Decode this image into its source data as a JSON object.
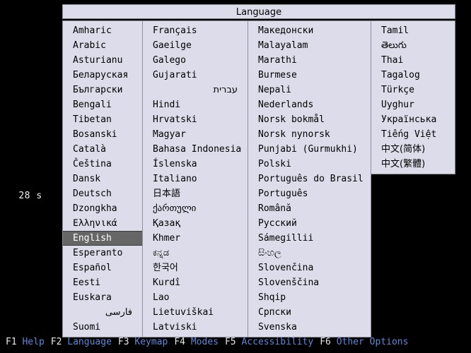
{
  "screen": {
    "background": "#000000",
    "timer": "28 s"
  },
  "dialog": {
    "title": "Language",
    "panel_bg": "#dcdcea",
    "selected_bg": "#666666",
    "selected_fg": "#ffffff",
    "columns": [
      {
        "name": "language-column-1",
        "items": [
          {
            "label": "Amharic",
            "selected": false,
            "script": "latin"
          },
          {
            "label": "Arabic",
            "selected": false,
            "script": "latin"
          },
          {
            "label": "Asturianu",
            "selected": false,
            "script": "latin"
          },
          {
            "label": "Беларуская",
            "selected": false,
            "script": "cyrillic"
          },
          {
            "label": "Български",
            "selected": false,
            "script": "cyrillic"
          },
          {
            "label": "Bengali",
            "selected": false,
            "script": "latin"
          },
          {
            "label": "Tibetan",
            "selected": false,
            "script": "latin"
          },
          {
            "label": "Bosanski",
            "selected": false,
            "script": "latin"
          },
          {
            "label": "Català",
            "selected": false,
            "script": "latin"
          },
          {
            "label": "Čeština",
            "selected": false,
            "script": "latin"
          },
          {
            "label": "Dansk",
            "selected": false,
            "script": "latin"
          },
          {
            "label": "Deutsch",
            "selected": false,
            "script": "latin"
          },
          {
            "label": "Dzongkha",
            "selected": false,
            "script": "latin"
          },
          {
            "label": "Ελληνικά",
            "selected": false,
            "script": "greek"
          },
          {
            "label": "English",
            "selected": true,
            "script": "latin"
          },
          {
            "label": "Esperanto",
            "selected": false,
            "script": "latin"
          },
          {
            "label": "Español",
            "selected": false,
            "script": "latin"
          },
          {
            "label": "Eesti",
            "selected": false,
            "script": "latin"
          },
          {
            "label": "Euskara",
            "selected": false,
            "script": "latin"
          },
          {
            "label": "فارسی",
            "selected": false,
            "script": "rtl"
          },
          {
            "label": "Suomi",
            "selected": false,
            "script": "latin"
          }
        ]
      },
      {
        "name": "language-column-2",
        "items": [
          {
            "label": "Français",
            "selected": false,
            "script": "latin"
          },
          {
            "label": "Gaeilge",
            "selected": false,
            "script": "latin"
          },
          {
            "label": "Galego",
            "selected": false,
            "script": "latin"
          },
          {
            "label": "Gujarati",
            "selected": false,
            "script": "latin"
          },
          {
            "label": "עברית",
            "selected": false,
            "script": "rtl"
          },
          {
            "label": "Hindi",
            "selected": false,
            "script": "latin"
          },
          {
            "label": "Hrvatski",
            "selected": false,
            "script": "latin"
          },
          {
            "label": "Magyar",
            "selected": false,
            "script": "latin"
          },
          {
            "label": "Bahasa Indonesia",
            "selected": false,
            "script": "latin"
          },
          {
            "label": "Íslenska",
            "selected": false,
            "script": "latin"
          },
          {
            "label": "Italiano",
            "selected": false,
            "script": "latin"
          },
          {
            "label": "日本語",
            "selected": false,
            "script": "cjk"
          },
          {
            "label": "ქართული",
            "selected": false,
            "script": "cjk"
          },
          {
            "label": "Қазақ",
            "selected": false,
            "script": "cyrillic"
          },
          {
            "label": "Khmer",
            "selected": false,
            "script": "latin"
          },
          {
            "label": "ಕನ್ನಡ",
            "selected": false,
            "script": "cjk"
          },
          {
            "label": "한국어",
            "selected": false,
            "script": "cjk"
          },
          {
            "label": "Kurdî",
            "selected": false,
            "script": "latin"
          },
          {
            "label": "Lao",
            "selected": false,
            "script": "latin"
          },
          {
            "label": "Lietuviškai",
            "selected": false,
            "script": "latin"
          },
          {
            "label": "Latviski",
            "selected": false,
            "script": "latin"
          }
        ]
      },
      {
        "name": "language-column-3",
        "items": [
          {
            "label": "Македонски",
            "selected": false,
            "script": "cyrillic"
          },
          {
            "label": "Malayalam",
            "selected": false,
            "script": "latin"
          },
          {
            "label": "Marathi",
            "selected": false,
            "script": "latin"
          },
          {
            "label": "Burmese",
            "selected": false,
            "script": "latin"
          },
          {
            "label": "Nepali",
            "selected": false,
            "script": "latin"
          },
          {
            "label": "Nederlands",
            "selected": false,
            "script": "latin"
          },
          {
            "label": "Norsk bokmål",
            "selected": false,
            "script": "latin"
          },
          {
            "label": "Norsk nynorsk",
            "selected": false,
            "script": "latin"
          },
          {
            "label": "Punjabi (Gurmukhi)",
            "selected": false,
            "script": "latin"
          },
          {
            "label": "Polski",
            "selected": false,
            "script": "latin"
          },
          {
            "label": "Português do Brasil",
            "selected": false,
            "script": "latin"
          },
          {
            "label": "Português",
            "selected": false,
            "script": "latin"
          },
          {
            "label": "Română",
            "selected": false,
            "script": "latin"
          },
          {
            "label": "Русский",
            "selected": false,
            "script": "cyrillic"
          },
          {
            "label": "Sámegillii",
            "selected": false,
            "script": "latin"
          },
          {
            "label": "සිංහල",
            "selected": false,
            "script": "cjk"
          },
          {
            "label": "Slovenčina",
            "selected": false,
            "script": "latin"
          },
          {
            "label": "Slovenščina",
            "selected": false,
            "script": "latin"
          },
          {
            "label": "Shqip",
            "selected": false,
            "script": "latin"
          },
          {
            "label": "Српски",
            "selected": false,
            "script": "cyrillic"
          },
          {
            "label": "Svenska",
            "selected": false,
            "script": "latin"
          }
        ]
      },
      {
        "name": "language-column-4",
        "items": [
          {
            "label": "Tamil",
            "selected": false,
            "script": "latin"
          },
          {
            "label": "తెలుగు",
            "selected": false,
            "script": "cjk"
          },
          {
            "label": "Thai",
            "selected": false,
            "script": "latin"
          },
          {
            "label": "Tagalog",
            "selected": false,
            "script": "latin"
          },
          {
            "label": "Türkçe",
            "selected": false,
            "script": "latin"
          },
          {
            "label": "Uyghur",
            "selected": false,
            "script": "latin"
          },
          {
            "label": "Українська",
            "selected": false,
            "script": "cyrillic"
          },
          {
            "label": "Tiếng Việt",
            "selected": false,
            "script": "latin"
          },
          {
            "label": "中文(简体)",
            "selected": false,
            "script": "cjk"
          },
          {
            "label": "中文(繁體)",
            "selected": false,
            "script": "cjk"
          }
        ]
      }
    ]
  },
  "function_bar": {
    "key_color": "#e8e8e8",
    "label_color": "#5f87d7",
    "keys": [
      {
        "key": "F1",
        "label": "Help"
      },
      {
        "key": "F2",
        "label": "Language"
      },
      {
        "key": "F3",
        "label": "Keymap"
      },
      {
        "key": "F4",
        "label": "Modes"
      },
      {
        "key": "F5",
        "label": "Accessibility"
      },
      {
        "key": "F6",
        "label": "Other Options"
      }
    ]
  }
}
